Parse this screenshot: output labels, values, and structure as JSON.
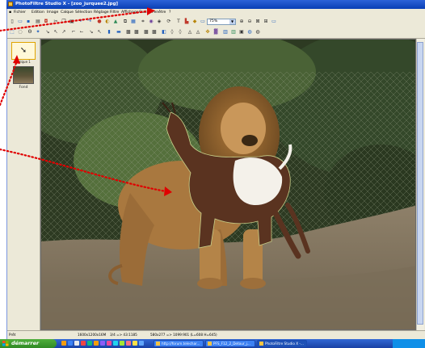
{
  "window": {
    "title": "PhotoFiltre Studio X - [zoo_jurquee2.jpg]"
  },
  "menu": {
    "items": [
      "Fichier",
      "Edition",
      "Image",
      "Calque",
      "Sélection",
      "Réglage",
      "Filtre",
      "Affichage",
      "Outils",
      "Fenêtre",
      "?"
    ]
  },
  "toolbar": {
    "zoom_value": "75%"
  },
  "layers": {
    "cursor_label": "Calque 1",
    "background_label": "Fond"
  },
  "status": {
    "ready": "Prêt",
    "dimensions": "1600x1200x16M",
    "zoom": "3/4 => 43:1185",
    "coords": "580x277 => 1099:901 (L=608 H=645)"
  },
  "taskbar": {
    "start_label": "démarrer",
    "tasks": [
      "http://forum.telechar...",
      "PFS_F12_2_Detour_j...",
      "PhotoFiltre Studio X -..."
    ]
  },
  "colors": {
    "titlebar": "#0a3fb4",
    "annotation": "#e00000",
    "start": "#2f8a24",
    "taskbar": "#1941a5"
  }
}
